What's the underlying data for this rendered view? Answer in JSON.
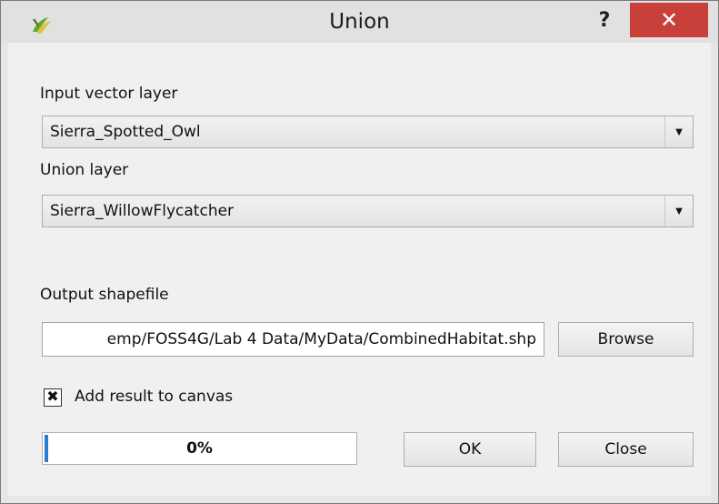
{
  "window": {
    "title": "Union",
    "help_label": "?",
    "close_label": "✕",
    "app_icon": "qgis-icon"
  },
  "form": {
    "input_layer_label": "Input vector layer",
    "input_layer_value": "Sierra_Spotted_Owl",
    "union_layer_label": "Union layer",
    "union_layer_value": "Sierra_WillowFlycatcher",
    "output_label": "Output shapefile",
    "output_value": "emp/FOSS4G/Lab 4 Data/MyData/CombinedHabitat.shp",
    "browse_label": "Browse",
    "add_to_canvas_label": "Add result to canvas",
    "add_to_canvas_checked": true
  },
  "progress": {
    "label": "0%",
    "value": 0
  },
  "buttons": {
    "ok_label": "OK",
    "close_label": "Close"
  },
  "colors": {
    "close_button": "#c7413a",
    "progress_fill": "#2a7dd6"
  }
}
